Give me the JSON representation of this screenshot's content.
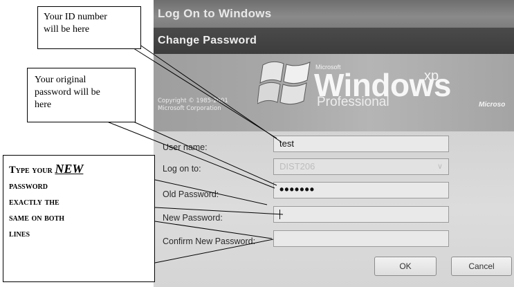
{
  "window": {
    "title": "Log On to Windows",
    "dialog_title": "Change Password"
  },
  "banner": {
    "copyright_line1": "Copyright © 1985-2001",
    "copyright_line2": "Microsoft Corporation",
    "microsoft_small": "Microsoft",
    "windows_word": "Windows",
    "xp": "xp",
    "edition": "Professional",
    "microsoft_right": "Microso"
  },
  "form": {
    "username_label": "User name:",
    "username_value": "test",
    "logon_label": "Log on to:",
    "logon_value": "DIST206",
    "old_password_label": "Old Password:",
    "old_password_mask": "•••••••",
    "new_password_label": "New Password:",
    "confirm_password_label": "Confirm New Password:",
    "ok_label": "OK",
    "cancel_label": "Cancel"
  },
  "callouts": {
    "id_line1": "Your ID number",
    "id_line2": "will be here",
    "orig_line1": "Your original",
    "orig_line2": "password will be",
    "orig_line3": "here",
    "new_line1_pre": "Type your ",
    "new_line1_em": "NEW",
    "new_line2": "password",
    "new_line3": "exactly the",
    "new_line4": "same on both",
    "new_line5": "lines"
  }
}
